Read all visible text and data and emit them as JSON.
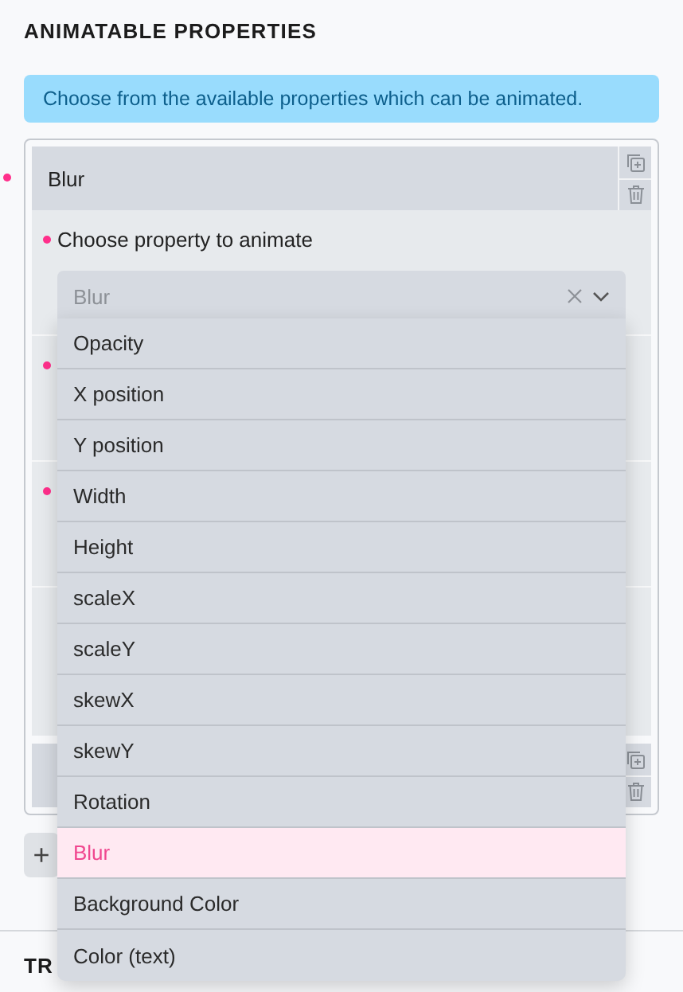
{
  "section_title": "ANIMATABLE PROPERTIES",
  "info": "Choose from the available properties which can be animated.",
  "items": [
    {
      "title": "Blur",
      "required": true,
      "fields": [
        {
          "label": "Choose property to animate",
          "required": true,
          "value": "Blur"
        },
        {
          "required": true
        },
        {
          "required": true
        },
        {
          "required": false
        }
      ]
    },
    {
      "required": false
    }
  ],
  "add_button": "+",
  "dropdown": [
    {
      "label": "Opacity",
      "selected": false
    },
    {
      "label": "X position",
      "selected": false
    },
    {
      "label": "Y position",
      "selected": false
    },
    {
      "label": "Width",
      "selected": false
    },
    {
      "label": "Height",
      "selected": false
    },
    {
      "label": "scaleX",
      "selected": false
    },
    {
      "label": "scaleY",
      "selected": false
    },
    {
      "label": "skewX",
      "selected": false
    },
    {
      "label": "skewY",
      "selected": false
    },
    {
      "label": "Rotation",
      "selected": false
    },
    {
      "label": "Blur",
      "selected": true
    },
    {
      "label": "Background Color",
      "selected": false
    },
    {
      "label": "Color (text)",
      "selected": false
    }
  ],
  "next_section_title": "TR"
}
